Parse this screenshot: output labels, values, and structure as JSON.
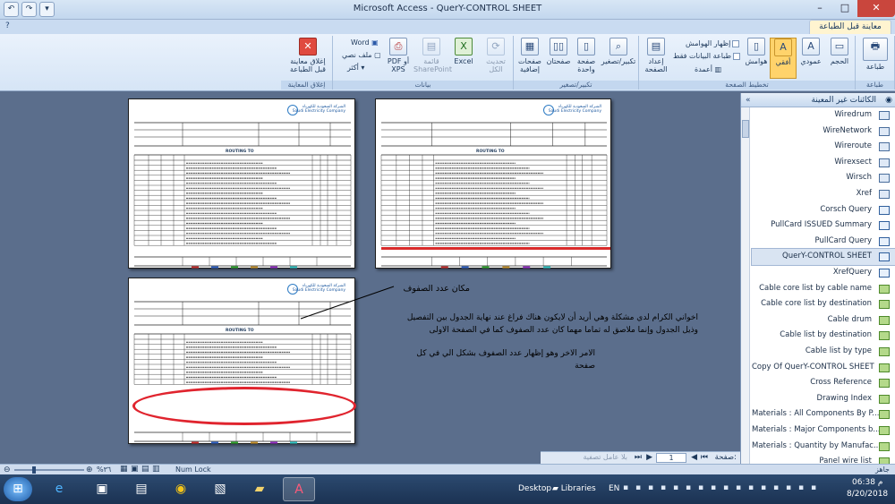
{
  "window": {
    "title": "Microsoft Access - QuerY-CONTROL SHEET"
  },
  "tabs": {
    "active": "معاينة قبل الطباعة"
  },
  "ribbon": {
    "groups": {
      "print": "طباعة",
      "page_layout": "تخطيط الصفحة",
      "zoom": "تكبير/تصغير",
      "data": "بيانات",
      "close_preview": "إغلاق المعاينة"
    },
    "print_button": "طباعة",
    "size_button": "الحجم",
    "portrait_button": "عمودي",
    "landscape_button": "أفقي",
    "margins_button": "هوامش",
    "show_margins": "إظهار الهوامش",
    "print_data_only": "طباعة البيانات فقط",
    "columns_button": "أعمدة",
    "page_setup_button": "إعداد الصفحة",
    "zoom_button": "تكبير/تصغير",
    "one_page_button": "صفحة واحدة",
    "two_pages_button": "صفحتان",
    "more_pages_button": "صفحات إضافية",
    "refresh_all_button": "تحديث الكل",
    "excel_button": "Excel",
    "sharepoint_button": "قائمة SharePoint",
    "pdf_button": "PDF أو XPS",
    "word_button": "Word",
    "text_file_button": "ملف نصي",
    "more_button": "أكثر",
    "close_preview_button": "إغلاق معاينة قبل الطباعة"
  },
  "nav_pane": {
    "header": "الكائنات غير المعينة",
    "items": [
      {
        "label": "Wiredrum",
        "type": "table"
      },
      {
        "label": "WireNetwork",
        "type": "table"
      },
      {
        "label": "Wireroute",
        "type": "table"
      },
      {
        "label": "Wirexsect",
        "type": "table"
      },
      {
        "label": "Wirsch",
        "type": "table"
      },
      {
        "label": "Xref",
        "type": "table"
      },
      {
        "label": "Corsch Query",
        "type": "query"
      },
      {
        "label": "PullCard ISSUED Summary",
        "type": "query"
      },
      {
        "label": "PullCard Query",
        "type": "query"
      },
      {
        "label": "QuerY-CONTROL SHEET",
        "type": "query",
        "selected": true
      },
      {
        "label": "XrefQuery",
        "type": "query"
      },
      {
        "label": "Cable core list by cable name",
        "type": "report"
      },
      {
        "label": "Cable core list by destination",
        "type": "report"
      },
      {
        "label": "Cable drum",
        "type": "report"
      },
      {
        "label": "Cable list by destination",
        "type": "report"
      },
      {
        "label": "Cable list by type",
        "type": "report"
      },
      {
        "label": "Copy Of QuerY-CONTROL SHEET",
        "type": "report"
      },
      {
        "label": "Cross Reference",
        "type": "report"
      },
      {
        "label": "Drawing Index",
        "type": "report"
      },
      {
        "label": "Materials : All Components By P...",
        "type": "report"
      },
      {
        "label": "Materials : Major Components b...",
        "type": "report"
      },
      {
        "label": "Materials : Quantity by Manufac...",
        "type": "report"
      },
      {
        "label": "Panel wire list",
        "type": "report"
      }
    ]
  },
  "report_sheet": {
    "company_ar": "الشركة السعودية للكهرباء",
    "company_en": "Saudi Electricity Company",
    "sheet_title": "ROUTING TO"
  },
  "annotations": {
    "arrow_label": "مكان عدد الصفوف",
    "paragraph1": "اخواني الكرام لدي مشكلة وهي أريد أن لايكون هناك فراغ عند نهاية الجدول بين التفصيل وذيل الجدول وإنما ملاصق له تماما مهما كان عدد الصفوف كما في الصفحة الاولى",
    "paragraph2": "الامر الاخر وهو إظهار عدد الصفوف بشكل الي في كل صفحة"
  },
  "status": {
    "page_label": "صفحة:",
    "page_value": "1",
    "filter_label": "بلا عامل تصفية",
    "zoom_value": "%٣٦",
    "num_lock": "Num Lock",
    "ready": "جاهز"
  },
  "taskbar": {
    "desktop": "Desktop",
    "libraries": "Libraries",
    "lang": "EN",
    "time": "06:38 م",
    "date": "8/20/2018"
  }
}
